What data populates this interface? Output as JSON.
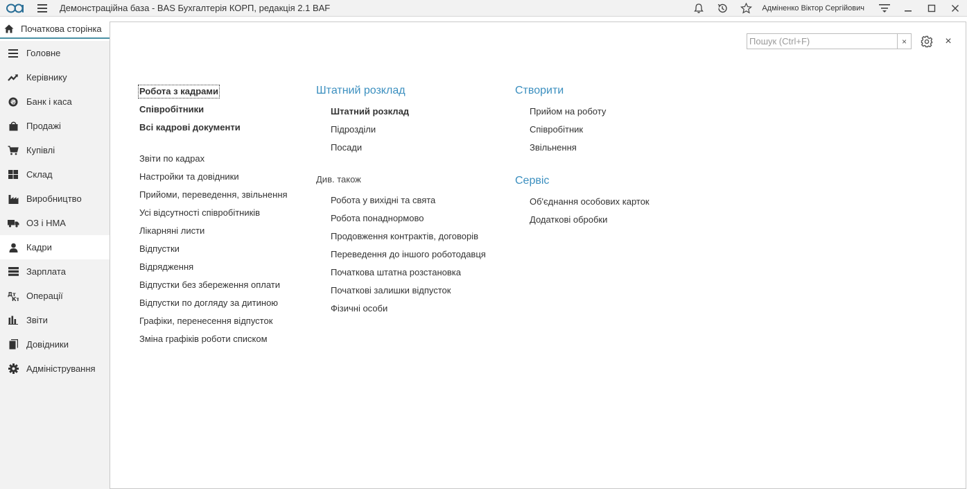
{
  "topbar": {
    "title": "Демонстраційна база - BAS Бухгалтерія КОРП, редакція 2.1 BAF",
    "user": "Адміненко Віктор Сергійович"
  },
  "home_tab": {
    "label": "Початкова сторінка"
  },
  "sidebar": {
    "items": [
      {
        "label": "Головне",
        "icon": "menu-lines-icon"
      },
      {
        "label": "Керівнику",
        "icon": "trend-icon"
      },
      {
        "label": "Банк і каса",
        "icon": "coin-icon"
      },
      {
        "label": "Продажі",
        "icon": "shopping-bag-icon"
      },
      {
        "label": "Купівлі",
        "icon": "cart-icon"
      },
      {
        "label": "Склад",
        "icon": "warehouse-grid-icon"
      },
      {
        "label": "Виробництво",
        "icon": "factory-icon"
      },
      {
        "label": "ОЗ і НМА",
        "icon": "truck-icon"
      },
      {
        "label": "Кадри",
        "icon": "person-icon"
      },
      {
        "label": "Зарплата",
        "icon": "money-icon"
      },
      {
        "label": "Операції",
        "icon": "dt-kt-icon"
      },
      {
        "label": "Звіти",
        "icon": "bar-chart-icon"
      },
      {
        "label": "Довідники",
        "icon": "books-icon"
      },
      {
        "label": "Адміністрування",
        "icon": "gear-icon"
      }
    ],
    "active_index": 8
  },
  "search": {
    "placeholder": "Пошук (Ctrl+F)",
    "value": "",
    "clear": "×"
  },
  "close_glyph": "×",
  "col1": {
    "main_links": [
      "Робота з кадрами",
      "Співробітники",
      "Всі кадрові документи"
    ],
    "links": [
      "Звіти по кадрах",
      "Настройки та довідники",
      "Прийоми, переведення, звільнення",
      "Усі відсутності співробітників",
      "Лікарняні листи",
      "Відпустки",
      "Відрядження",
      "Відпустки без збереження оплати",
      "Відпустки по догляду за дитиною",
      "Графіки, перенесення відпусток",
      "Зміна графіків роботи списком"
    ]
  },
  "col2": {
    "title": "Штатний розклад",
    "links": [
      "Штатний розклад",
      "Підрозділи",
      "Посади"
    ],
    "see_also_label": "Див. також",
    "see_also": [
      "Робота у вихідні та свята",
      "Робота понаднормово",
      "Продовження контрактів, договорів",
      "Переведення до іншого роботодавця",
      "Початкова штатна розстановка",
      "Початкові залишки відпусток",
      "Фізичні особи"
    ]
  },
  "col3": {
    "create_title": "Створити",
    "create_links": [
      "Прийом на роботу",
      "Співробітник",
      "Звільнення"
    ],
    "service_title": "Сервіс",
    "service_links": [
      "Об'єднання особових карток",
      "Додаткові обробки"
    ]
  }
}
